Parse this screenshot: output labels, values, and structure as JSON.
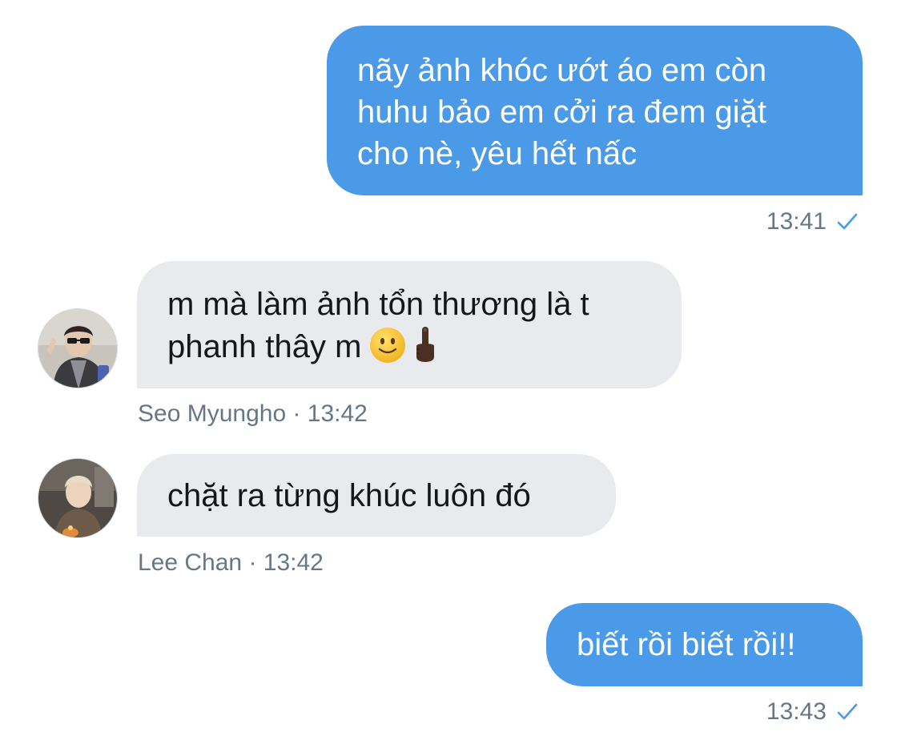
{
  "messages": [
    {
      "direction": "outgoing",
      "lines": [
        "nãy ảnh khóc ướt áo em còn",
        "huhu bảo em cởi ra đem giặt",
        "cho nè, yêu hết nấc"
      ],
      "time": "13:41",
      "status_icon": "checkmark-icon"
    },
    {
      "direction": "incoming",
      "lines": [
        "m mà làm ảnh tổn thương là t",
        "phanh thây m"
      ],
      "emojis": [
        "slightly-smiling-face-emoji",
        "middle-finger-emoji"
      ],
      "sender": "Seo Myungho",
      "time": "13:42",
      "meta": "Seo Myungho · 13:42",
      "avatar": "seo-myungho-avatar"
    },
    {
      "direction": "incoming",
      "lines": [
        "chặt ra từng khúc luôn đó"
      ],
      "sender": "Lee Chan",
      "time": "13:42",
      "meta": "Lee Chan · 13:42",
      "avatar": "lee-chan-avatar"
    },
    {
      "direction": "outgoing",
      "lines": [
        "biết rồi biết rồi!!"
      ],
      "time": "13:43",
      "status_icon": "checkmark-icon"
    }
  ],
  "colors": {
    "outgoing_bubble": "#4a9ae8",
    "incoming_bubble": "#e8eaee",
    "meta_text": "#657786",
    "check": "#4a9ae8"
  }
}
